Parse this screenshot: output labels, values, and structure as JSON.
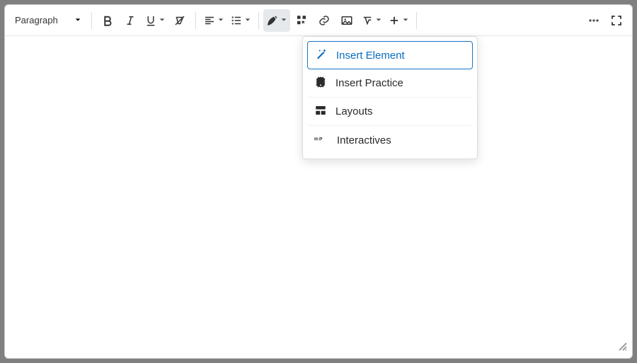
{
  "toolbar": {
    "style_select": "Paragraph",
    "insert_stuff_active": true
  },
  "dropdown": {
    "items": [
      {
        "label": "Insert Element",
        "icon": "wand",
        "highlighted": true
      },
      {
        "label": "Insert Practice",
        "icon": "question-badge",
        "highlighted": false
      },
      {
        "label": "Layouts",
        "icon": "layouts",
        "highlighted": false
      },
      {
        "label": "Interactives",
        "icon": "h5p",
        "highlighted": false
      }
    ]
  }
}
